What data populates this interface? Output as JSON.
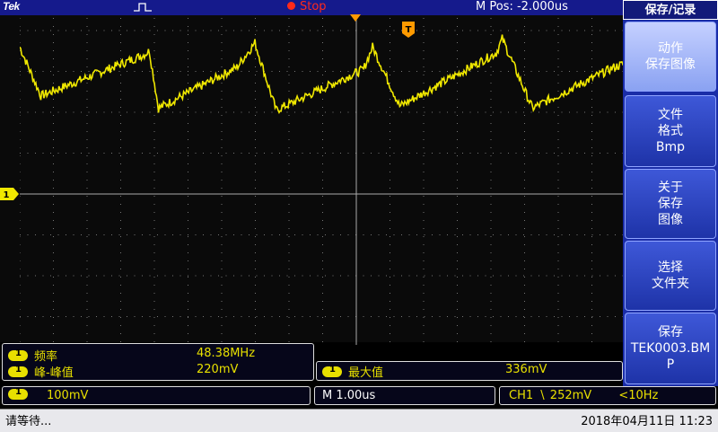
{
  "header": {
    "brand": "Tek",
    "run_state": "Stop",
    "m_pos": "M Pos: -2.000us"
  },
  "menu": {
    "title": "保存/记录",
    "buttons": [
      {
        "lines": [
          "动作",
          "保存图像"
        ],
        "active": true
      },
      {
        "lines": [
          "文件",
          "格式",
          "Bmp"
        ],
        "active": false
      },
      {
        "lines": [
          "关于",
          "保存",
          "图像"
        ],
        "active": false
      },
      {
        "lines": [
          "选择",
          "文件夹"
        ],
        "active": false
      },
      {
        "lines": [
          "保存",
          "TEK0003.BM",
          "P"
        ],
        "active": false
      }
    ]
  },
  "measurements": {
    "freq_label": "频率",
    "freq_value": "48.38MHz",
    "pkpk_label": "峰-峰值",
    "pkpk_value": "220mV",
    "max_label": "最大值",
    "max_value": "336mV"
  },
  "status": {
    "ch1_scale": "100mV",
    "timebase": "M 1.00us",
    "trigger_channel": "CH1",
    "trigger_slope": "\\",
    "trigger_level": "252mV",
    "trigger_freq": "<10Hz"
  },
  "footer": {
    "message": "请等待...",
    "datetime": "2018年04月11日 11:23"
  },
  "colors": {
    "trace": "#f0e800",
    "header_bg": "#151a8c",
    "menu_bg": "#1a2da8",
    "stop": "#ff2a1a",
    "trigger_marker": "#ff9a00"
  },
  "chart_data": {
    "type": "line",
    "title": "",
    "xlabel": "",
    "ylabel": "",
    "grid": true,
    "x_divisions": 10,
    "y_divisions": 8,
    "y_per_div_mV": 100,
    "time_per_div_us": 1.0,
    "series": [
      {
        "name": "",
        "points_div": [
          [
            0.0,
            3.6
          ],
          [
            0.35,
            2.4
          ],
          [
            2.05,
            3.4
          ],
          [
            2.15,
            3.5
          ],
          [
            2.3,
            2.1
          ],
          [
            3.6,
            3.1
          ],
          [
            3.9,
            3.7
          ],
          [
            4.25,
            2.05
          ],
          [
            5.7,
            3.05
          ],
          [
            5.85,
            3.6
          ],
          [
            6.3,
            2.15
          ],
          [
            7.9,
            3.45
          ],
          [
            8.0,
            3.8
          ],
          [
            8.5,
            2.1
          ],
          [
            9.85,
            3.1
          ],
          [
            10.05,
            3.2
          ]
        ]
      }
    ]
  }
}
